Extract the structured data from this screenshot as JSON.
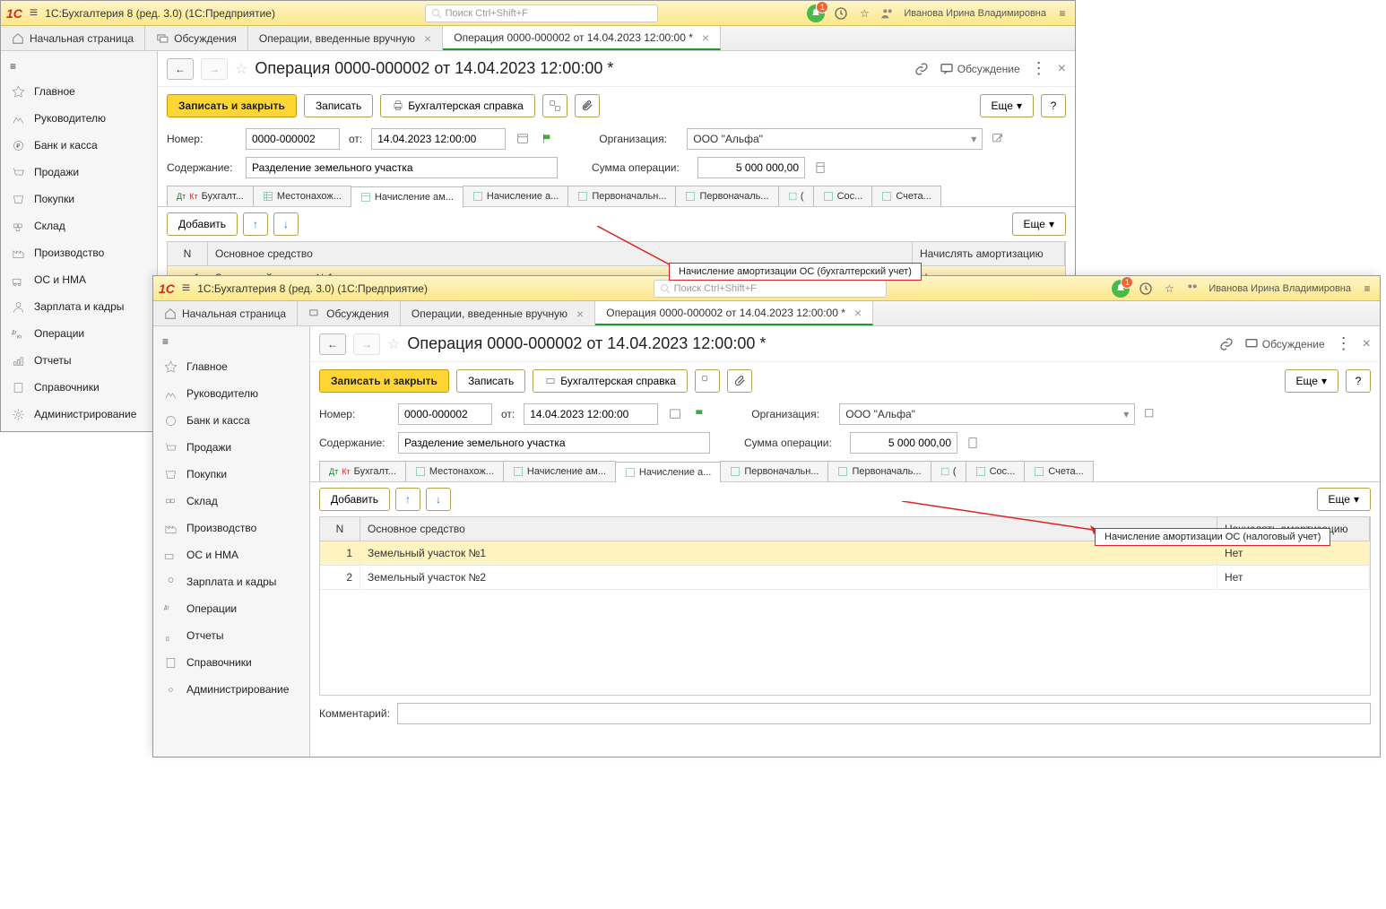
{
  "appTitle": "1С:Бухгалтерия 8 (ред. 3.0)  (1С:Предприятие)",
  "searchPlaceholder": "Поиск Ctrl+Shift+F",
  "bellCount": "1",
  "userName": "Иванова Ирина Владимировна",
  "mainTabs": [
    {
      "label": "Начальная страница",
      "icon": "home"
    },
    {
      "label": "Обсуждения",
      "icon": "discuss"
    },
    {
      "label": "Операции, введенные вручную",
      "closable": true
    },
    {
      "label": "Операция 0000-000002 от 14.04.2023 12:00:00 *",
      "closable": true,
      "active": true
    }
  ],
  "sidebar": [
    "Главное",
    "Руководителю",
    "Банк и касса",
    "Продажи",
    "Покупки",
    "Склад",
    "Производство",
    "ОС и НМА",
    "Зарплата и кадры",
    "Операции",
    "Отчеты",
    "Справочники",
    "Администрирование"
  ],
  "doc": {
    "title": "Операция 0000-000002 от 14.04.2023 12:00:00 *",
    "saveClose": "Записать и закрыть",
    "save": "Записать",
    "print": "Бухгалтерская справка",
    "more": "Еще",
    "help": "?",
    "discuss": "Обсуждение",
    "numberLabel": "Номер:",
    "numberValue": "0000-000002",
    "fromLabel": "от:",
    "dateValue": "14.04.2023 12:00:00",
    "orgLabel": "Организация:",
    "orgValue": "ООО \"Альфа\"",
    "contentLabel": "Содержание:",
    "contentValue": "Разделение земельного участка",
    "sumLabel": "Сумма операции:",
    "sumValue": "5 000 000,00",
    "commentLabel": "Комментарий:"
  },
  "innerTabs": [
    {
      "label": "Бухгалт...",
      "icon": "dtkt"
    },
    {
      "label": "Местонахож...",
      "icon": "grid"
    },
    {
      "label": "Начисление ам...",
      "icon": "grid"
    },
    {
      "label": "Начисление а...",
      "icon": "grid"
    },
    {
      "label": "Первоначальн...",
      "icon": "grid"
    },
    {
      "label": "Первоначаль...",
      "icon": "grid"
    },
    {
      "label": "(",
      "icon": "grid"
    },
    {
      "label": "Сос...",
      "icon": "grid"
    },
    {
      "label": "Счета...",
      "icon": "grid"
    }
  ],
  "tableToolbar": {
    "add": "Добавить"
  },
  "tableHead": {
    "n": "N",
    "asset": "Основное средство",
    "amort": "Начислять амортизацию"
  },
  "rows": [
    {
      "n": "1",
      "asset": "Земельный участок №1",
      "amort": "Нет",
      "sel": true
    },
    {
      "n": "2",
      "asset": "Земельный участок №2",
      "amort": "Нет"
    }
  ],
  "callout1": "Начисление амортизации ОС (бухгалтерский учет)",
  "callout2": "Начисление амортизации ОС (налоговый учет)"
}
